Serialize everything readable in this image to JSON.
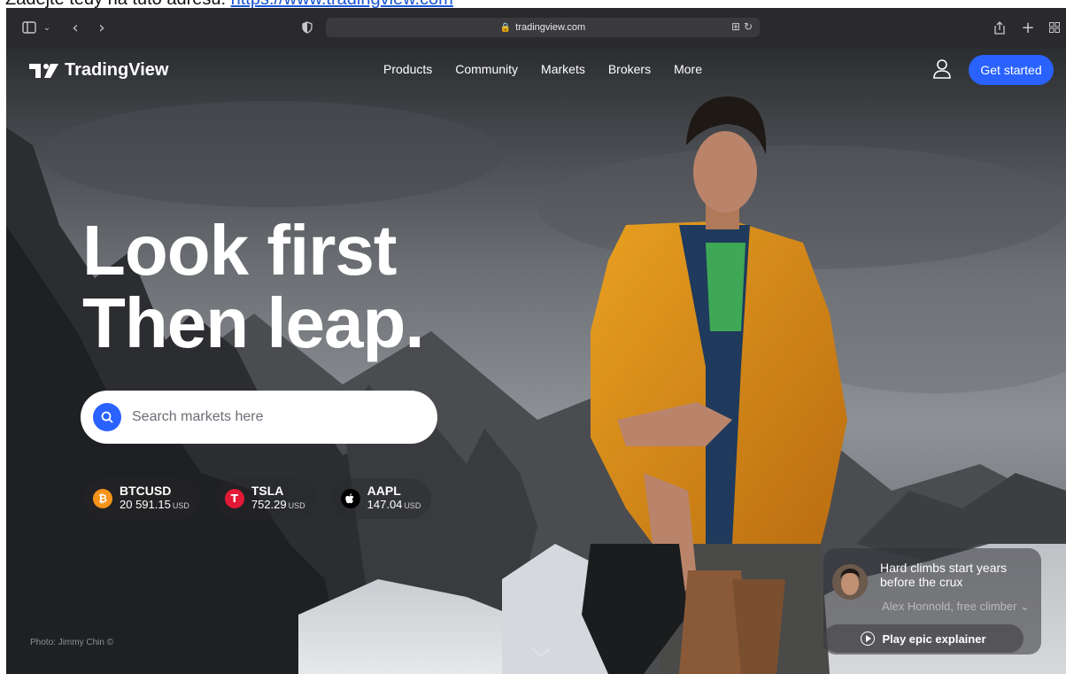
{
  "instruction": {
    "prefix": "Zadejte tedy na tuto adresu: ",
    "url": "https://www.tradingview.com"
  },
  "browser": {
    "address": "tradingview.com",
    "icons": [
      "sidebar-icon",
      "chevron-down-icon",
      "back-icon",
      "forward-icon",
      "privacy-shield-icon",
      "lock-icon",
      "translate-icon",
      "reload-icon",
      "share-icon",
      "new-tab-icon",
      "tab-overview-icon"
    ]
  },
  "nav": {
    "logo": "TradingView",
    "links": [
      "Products",
      "Community",
      "Markets",
      "Brokers",
      "More"
    ],
    "cta": "Get started"
  },
  "hero": {
    "line1": "Look first",
    "line2": "Then leap.",
    "search_placeholder": "Search markets here"
  },
  "tickers": [
    {
      "symbol": "BTCUSD",
      "price": "20 591.15",
      "currency": "USD",
      "color": "#f7931a",
      "icon": "bitcoin-icon"
    },
    {
      "symbol": "TSLA",
      "price": "752.29",
      "currency": "USD",
      "color": "#e31937",
      "icon": "tesla-icon"
    },
    {
      "symbol": "AAPL",
      "price": "147.04",
      "currency": "USD",
      "color": "#000000",
      "icon": "apple-icon"
    }
  ],
  "quote": {
    "text": "Hard climbs start years before the crux",
    "author": "Alex Honnold, free climber",
    "button": "Play epic explainer"
  },
  "credit": "Photo: Jimmy Chin ©",
  "colors": {
    "accent": "#2962ff",
    "toolbar": "#2a2a2d"
  }
}
